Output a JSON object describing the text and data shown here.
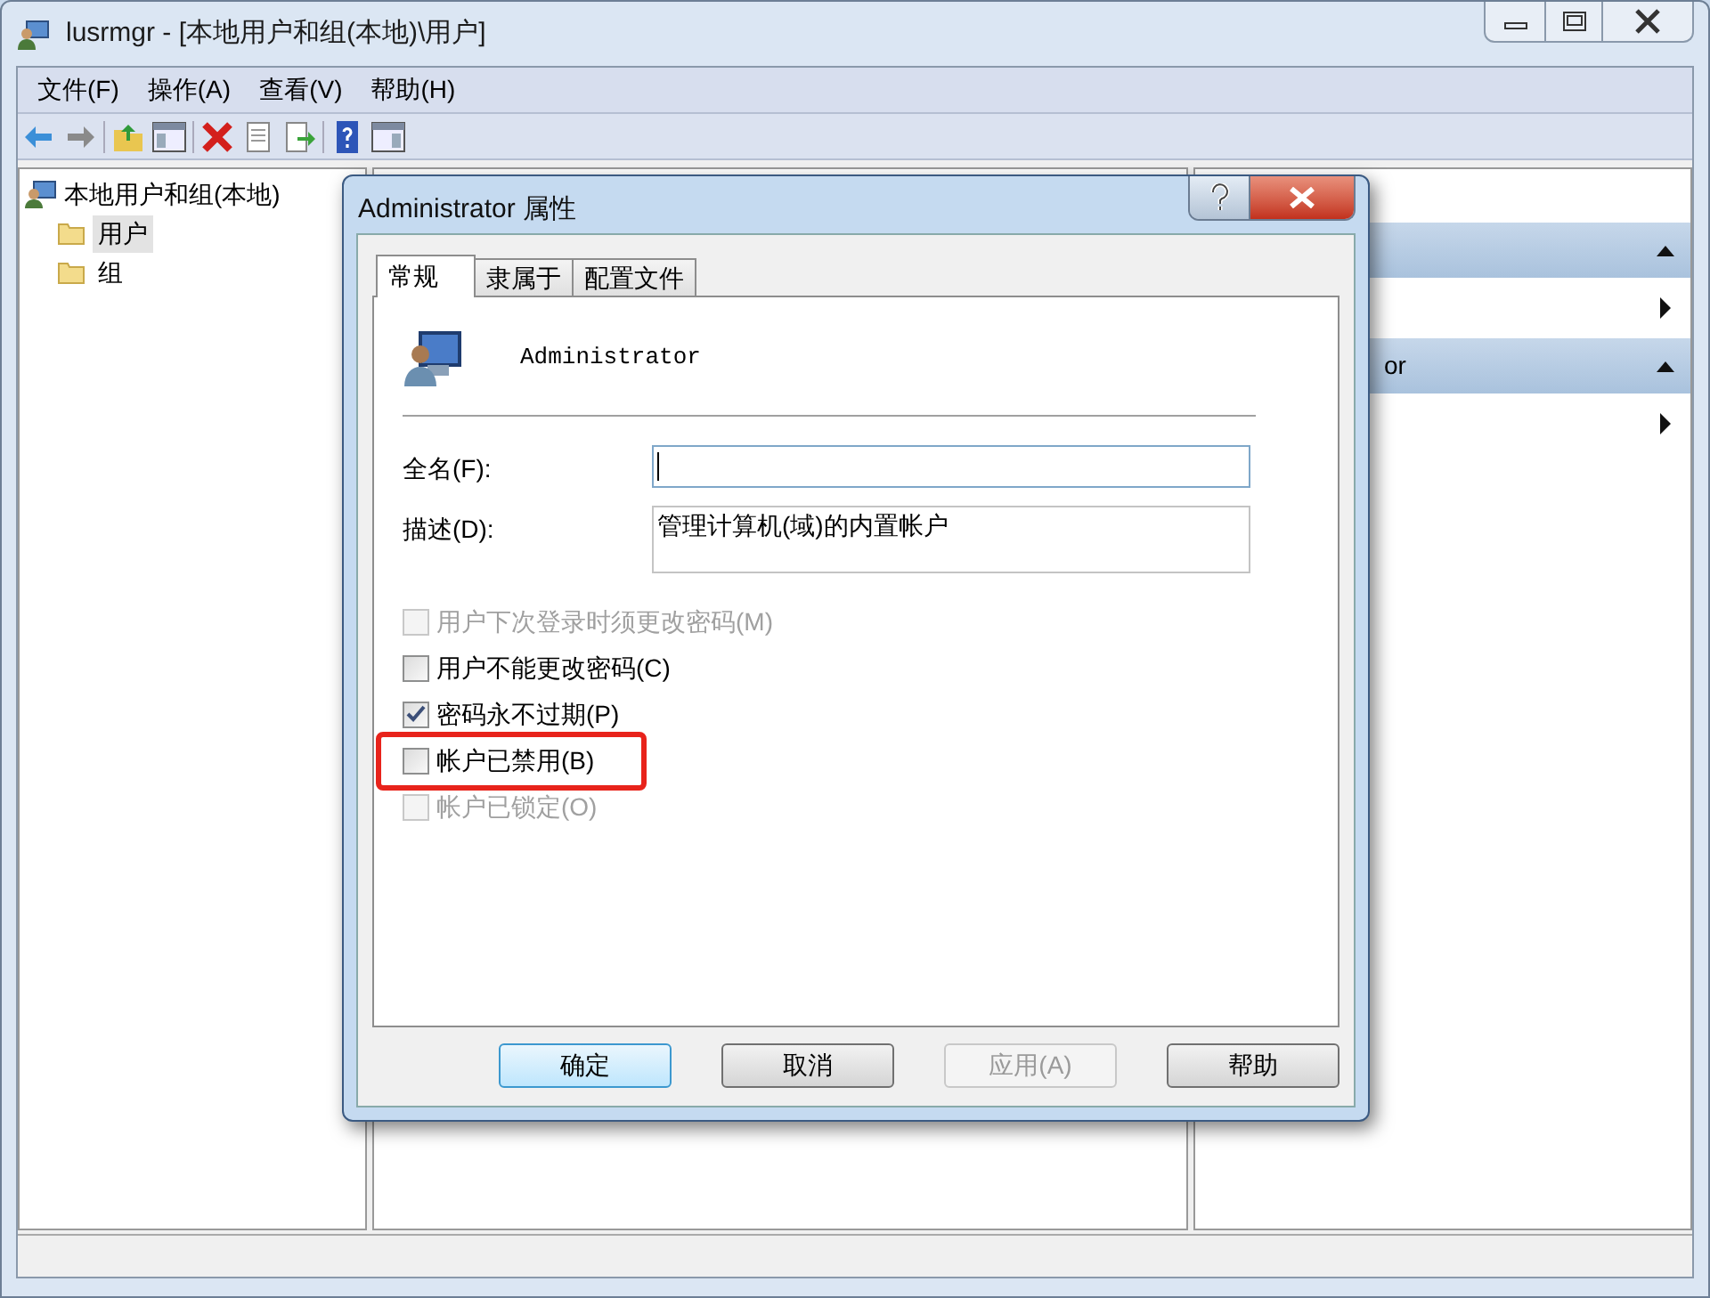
{
  "window": {
    "title": "lusrmgr - [本地用户和组(本地)\\用户]"
  },
  "menu": [
    "文件(F)",
    "操作(A)",
    "查看(V)",
    "帮助(H)"
  ],
  "tree": {
    "label": "本地用户和组(本地)",
    "children": [
      {
        "label": "用户",
        "selected": true
      },
      {
        "label": "组",
        "selected": false
      }
    ]
  },
  "actions_pane": {
    "sections": [
      {
        "expanded": true
      },
      {
        "title": "or",
        "expanded": true
      }
    ]
  },
  "dialog": {
    "title": "Administrator 属性",
    "tabs": [
      {
        "label": "常规",
        "selected": true
      },
      {
        "label": "隶属于",
        "selected": false
      },
      {
        "label": "配置文件",
        "selected": false
      }
    ],
    "user_name": "Administrator",
    "fields": [
      {
        "kind": "line",
        "label": "全名(F):",
        "focused": true
      },
      {
        "kind": "area",
        "label": "描述(D):",
        "value": "管理计算机(域)的内置帐户",
        "focused": false
      }
    ],
    "checkboxes": [
      {
        "label": "用户下次登录时须更改密码(M)",
        "checked": false,
        "disabled": true,
        "highlighted": false
      },
      {
        "label": "用户不能更改密码(C)",
        "checked": false,
        "disabled": false,
        "highlighted": false
      },
      {
        "label": "密码永不过期(P)",
        "checked": true,
        "disabled": false,
        "highlighted": false
      },
      {
        "label": "帐户已禁用(B)",
        "checked": false,
        "disabled": false,
        "highlighted": true
      },
      {
        "label": "帐户已锁定(O)",
        "checked": false,
        "disabled": true,
        "highlighted": false
      }
    ],
    "buttons": [
      {
        "label": "确定",
        "default": true,
        "disabled": false
      },
      {
        "label": "取消",
        "default": false,
        "disabled": false
      },
      {
        "label": "应用(A)",
        "default": false,
        "disabled": true
      },
      {
        "label": "帮助",
        "default": false,
        "disabled": false
      }
    ]
  }
}
